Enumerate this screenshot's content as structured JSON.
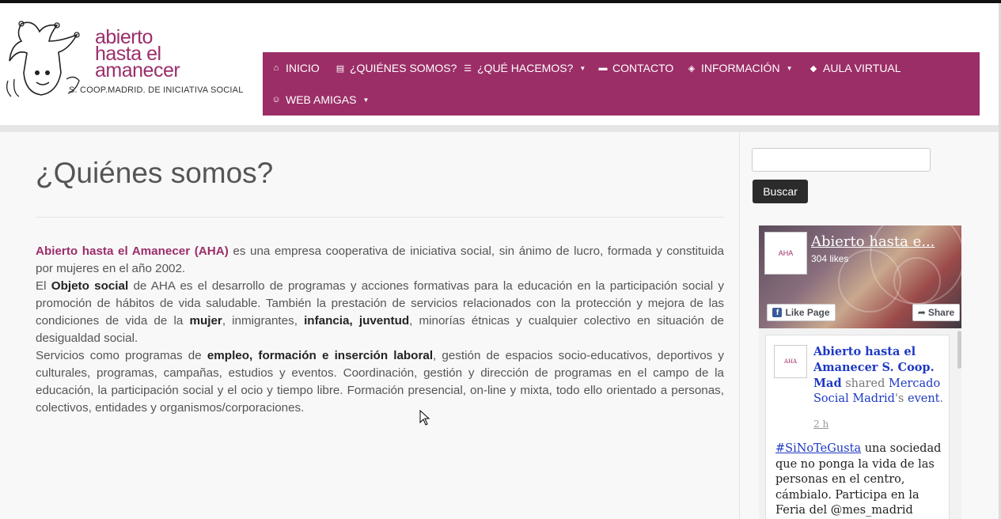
{
  "header": {
    "logo": {
      "line1": "abierto",
      "line2": "hasta el",
      "line3": "amanecer",
      "subtitle": "S. COOP.MADRID. DE INICIATIVA SOCIAL"
    }
  },
  "nav": {
    "items": [
      {
        "label": "INICIO",
        "icon": "home-icon"
      },
      {
        "label": "¿QUIÉNES SOMOS?",
        "icon": "calendar-icon"
      },
      {
        "label": "¿QUÉ HACEMOS?",
        "icon": "list-icon",
        "dropdown": true
      },
      {
        "label": "CONTACTO",
        "icon": "comment-icon"
      },
      {
        "label": "INFORMACIÓN",
        "icon": "tag-icon",
        "dropdown": true
      },
      {
        "label": "AULA VIRTUAL",
        "icon": "graduation-cap-icon"
      },
      {
        "label": "WEB AMIGAS",
        "icon": "smile-icon",
        "dropdown": true
      }
    ]
  },
  "main": {
    "title": "¿Quiénes somos?",
    "p1": {
      "brand": "Abierto hasta el Amanecer (AHA)",
      "rest": " es una empresa cooperativa de iniciativa social, sin ánimo de lucro, formada y constituida por mujeres en el año 2002."
    },
    "p2": {
      "a": "El ",
      "b1": "Objeto social",
      "c": " de AHA es el desarrollo de programas y acciones formativas para la educación en la participación social y promoción de hábitos de vida saludable. También la prestación de servicios relacionados con la protección y mejora de las condiciones de vida de la ",
      "b2": "mujer",
      "d": ", inmigrantes, ",
      "b3": "infancia, juventud",
      "e": ", minorías étnicas y cualquier colectivo en situación de desigualdad social."
    },
    "p3": {
      "a": "Servicios como programas de ",
      "b1": "empleo, formación e inserción laboral",
      "c": ", gestión de espacios socio-educativos, deportivos y culturales, programas, campañas, estudios y eventos. Coordinación, gestión y dirección de programas en el campo de la educación, la participación social y el ocio y tiempo libre. Formación presencial, on-line y mixta, todo ello orientado a personas, colectivos, entidades y organismos/corporaciones."
    }
  },
  "sidebar": {
    "search": {
      "placeholder": "",
      "button_label": "Buscar"
    },
    "facebook": {
      "page_name": "Abierto hasta e...",
      "likes": "304 likes",
      "like_label": "Like Page",
      "share_label": "Share",
      "post": {
        "author": "Abierto hasta el Amanecer S. Coop. Mad",
        "shared": "shared",
        "target": "Mercado Social Madrid",
        "possessive": "'s",
        "object": "event",
        "period": ".",
        "time": "2 h",
        "hashtag": "#SiNoTeGusta",
        "text": " una sociedad que no ponga la vida de las personas en el centro, cámbialo. Participa en la Feria del @mes_madrid"
      }
    }
  },
  "colors": {
    "brand": "#9b2e67",
    "nav_text": "#ffffff",
    "button_dark": "#2b2b2b",
    "link": "#1d39c4"
  }
}
